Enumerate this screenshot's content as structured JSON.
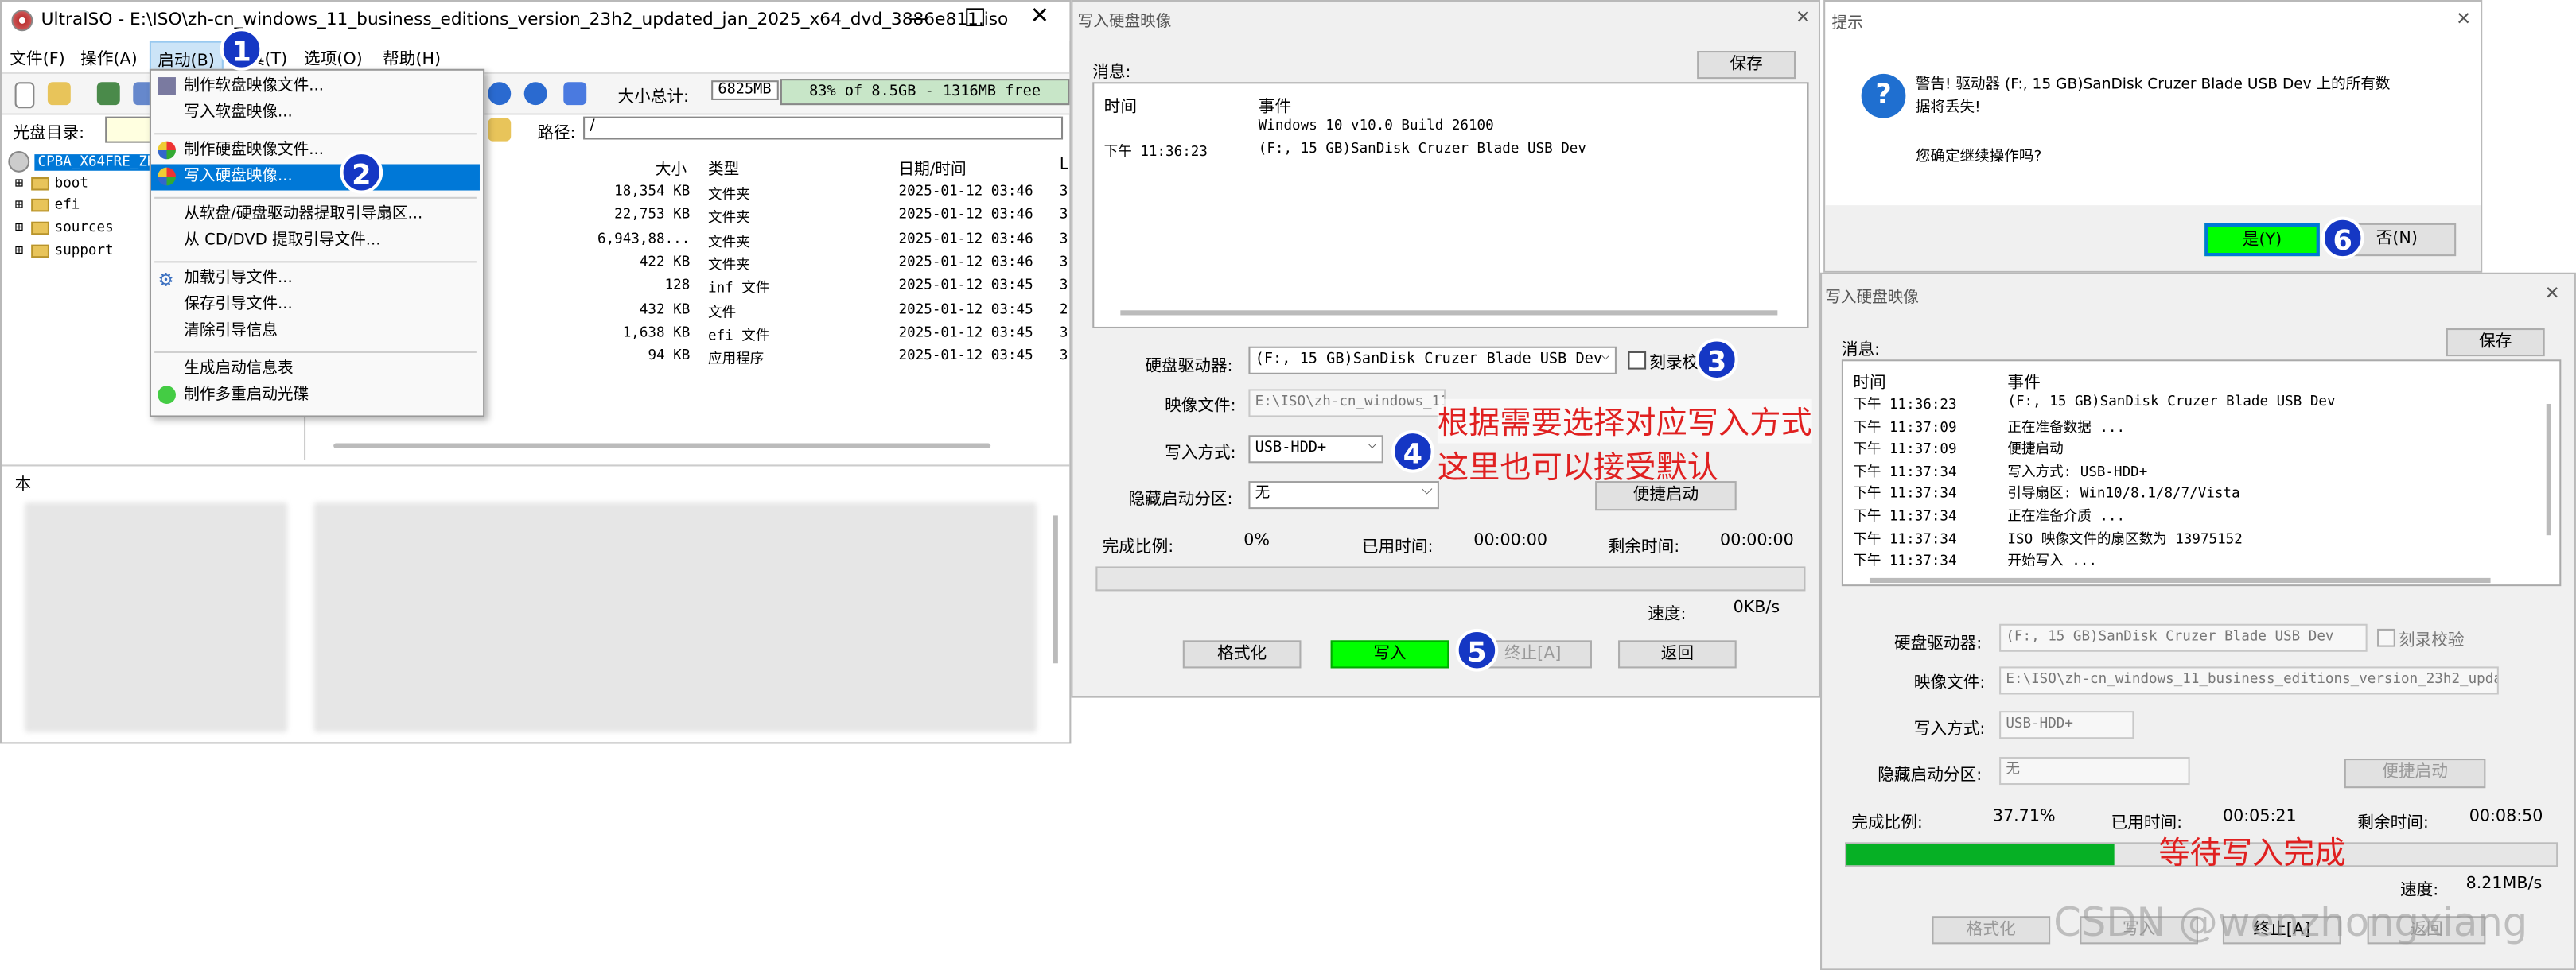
{
  "ultraiso": {
    "title": "UltraISO - E:\\ISO\\zh-cn_windows_11_business_editions_version_23h2_updated_jan_2025_x64_dvd_3886e811.iso",
    "menu": [
      "文件(F)",
      "操作(A)",
      "启动(B)",
      "工具(T)",
      "选项(O)",
      "帮助(H)"
    ],
    "size_total_label": "大小总计:",
    "size_total_value": "6825MB",
    "size_bar_text": "83% of 8.5GB - 1316MB free",
    "disc_dir_label": "光盘目录:",
    "path_label": "路径:",
    "path_value": "/",
    "tree_root": "CPBA_X64FRE_ZH-CN_DV9",
    "tree_items": [
      "boot",
      "efi",
      "sources",
      "support"
    ],
    "local_label": "本",
    "columns": {
      "size": "大小",
      "type": "类型",
      "date": "日期/时间",
      "l": "L"
    },
    "files": [
      {
        "size": "18,354 KB",
        "type": "文件夹",
        "date": "2025-01-12 03:46",
        "l": "3"
      },
      {
        "size": "22,753 KB",
        "type": "文件夹",
        "date": "2025-01-12 03:46",
        "l": "3"
      },
      {
        "size": "6,943,88...",
        "type": "文件夹",
        "date": "2025-01-12 03:46",
        "l": "3"
      },
      {
        "size": "422 KB",
        "type": "文件夹",
        "date": "2025-01-12 03:46",
        "l": "3"
      },
      {
        "size": "128",
        "type": "inf 文件",
        "date": "2025-01-12 03:45",
        "l": "3"
      },
      {
        "size": "432 KB",
        "type": "文件",
        "date": "2025-01-12 03:45",
        "l": "2"
      },
      {
        "size": "1,638 KB",
        "type": "efi 文件",
        "date": "2025-01-12 03:45",
        "l": "3"
      },
      {
        "size": "94 KB",
        "type": "应用程序",
        "date": "2025-01-12 03:45",
        "l": "3"
      }
    ],
    "boot_menu": [
      "制作软盘映像文件...",
      "写入软盘映像...",
      "制作硬盘映像文件...",
      "写入硬盘映像...",
      "从软盘/硬盘驱动器提取引导扇区...",
      "从 CD/DVD 提取引导文件...",
      "加载引导文件...",
      "保存引导文件...",
      "清除引导信息",
      "生成启动信息表",
      "制作多重启动光碟"
    ]
  },
  "write_dialog": {
    "title": "写入硬盘映像",
    "msg_label": "消息:",
    "save": "保存",
    "col_time": "时间",
    "col_event": "事件",
    "log": [
      {
        "time": "",
        "event": "Windows 10 v10.0 Build 26100"
      },
      {
        "time": "下午 11:36:23",
        "event": "(F:, 15 GB)SanDisk Cruzer Blade USB Dev"
      }
    ],
    "drive_label": "硬盘驱动器:",
    "drive_value": "(F:, 15 GB)SanDisk Cruzer Blade USB Dev",
    "verify_label": "刻录校验",
    "image_label": "映像文件:",
    "image_value": "E:\\ISO\\zh-cn_windows_11_business_editions_version_23h2_upda",
    "mode_label": "写入方式:",
    "mode_value": "USB-HDD+",
    "hide_label": "隐藏启动分区:",
    "hide_value": "无",
    "quick_boot": "便捷启动",
    "progress_label": "完成比例:",
    "progress_value": "0%",
    "elapsed_label": "已用时间:",
    "elapsed_value": "00:00:00",
    "remain_label": "剩余时间:",
    "remain_value": "00:00:00",
    "speed_label": "速度:",
    "speed_value": "0KB/s",
    "format": "格式化",
    "write": "写入",
    "stop": "终止[A]",
    "back": "返回",
    "progress": 0
  },
  "prompt_dialog": {
    "title": "提示",
    "message": "警告! 驱动器 (F:, 15 GB)SanDisk Cruzer Blade USB Dev 上的所有数据将丢失!",
    "confirm": "您确定继续操作吗?",
    "yes": "是(Y)",
    "no": "否(N)"
  },
  "progress_dialog": {
    "title": "写入硬盘映像",
    "msg_label": "消息:",
    "save": "保存",
    "col_time": "时间",
    "col_event": "事件",
    "log": [
      {
        "time": "下午 11:36:23",
        "event": "(F:, 15 GB)SanDisk Cruzer Blade USB Dev"
      },
      {
        "time": "下午 11:37:09",
        "event": "正在准备数据 ..."
      },
      {
        "time": "下午 11:37:09",
        "event": "便捷启动"
      },
      {
        "time": "下午 11:37:34",
        "event": "写入方式: USB-HDD+"
      },
      {
        "time": "下午 11:37:34",
        "event": "引导扇区: Win10/8.1/8/7/Vista"
      },
      {
        "time": "下午 11:37:34",
        "event": "正在准备介质 ..."
      },
      {
        "time": "下午 11:37:34",
        "event": "ISO 映像文件的扇区数为 13975152"
      },
      {
        "time": "下午 11:37:34",
        "event": "开始写入 ..."
      }
    ],
    "drive_label": "硬盘驱动器:",
    "drive_value": "(F:, 15 GB)SanDisk Cruzer Blade USB Dev",
    "verify_label": "刻录校验",
    "image_label": "映像文件:",
    "image_value": "E:\\ISO\\zh-cn_windows_11_business_editions_version_23h2_upda",
    "mode_label": "写入方式:",
    "mode_value": "USB-HDD+",
    "hide_label": "隐藏启动分区:",
    "hide_value": "无",
    "quick_boot": "便捷启动",
    "progress_label": "完成比例:",
    "progress_value": "37.71%",
    "progress": 0.3771,
    "elapsed_label": "已用时间:",
    "elapsed_value": "00:05:21",
    "remain_label": "剩余时间:",
    "remain_value": "00:08:50",
    "speed_label": "速度:",
    "speed_value": "8.21MB/s",
    "format": "格式化",
    "write": "写入",
    "stop": "终止[A]",
    "back": "返回"
  },
  "annotations": {
    "badges": [
      "1",
      "2",
      "3",
      "4",
      "5",
      "6"
    ],
    "choose_mode": "根据需要选择对应写入方式",
    "accept_default": "这里也可以接受默认",
    "wait_done": "等待写入完成",
    "watermark": "CSDN @wenzhongxiang"
  },
  "colors": {
    "highlight": "#0078d7",
    "write_btn": "#00ff00",
    "progress": "#06b025",
    "annotation": "#e02020",
    "badge": "#1537c4"
  }
}
